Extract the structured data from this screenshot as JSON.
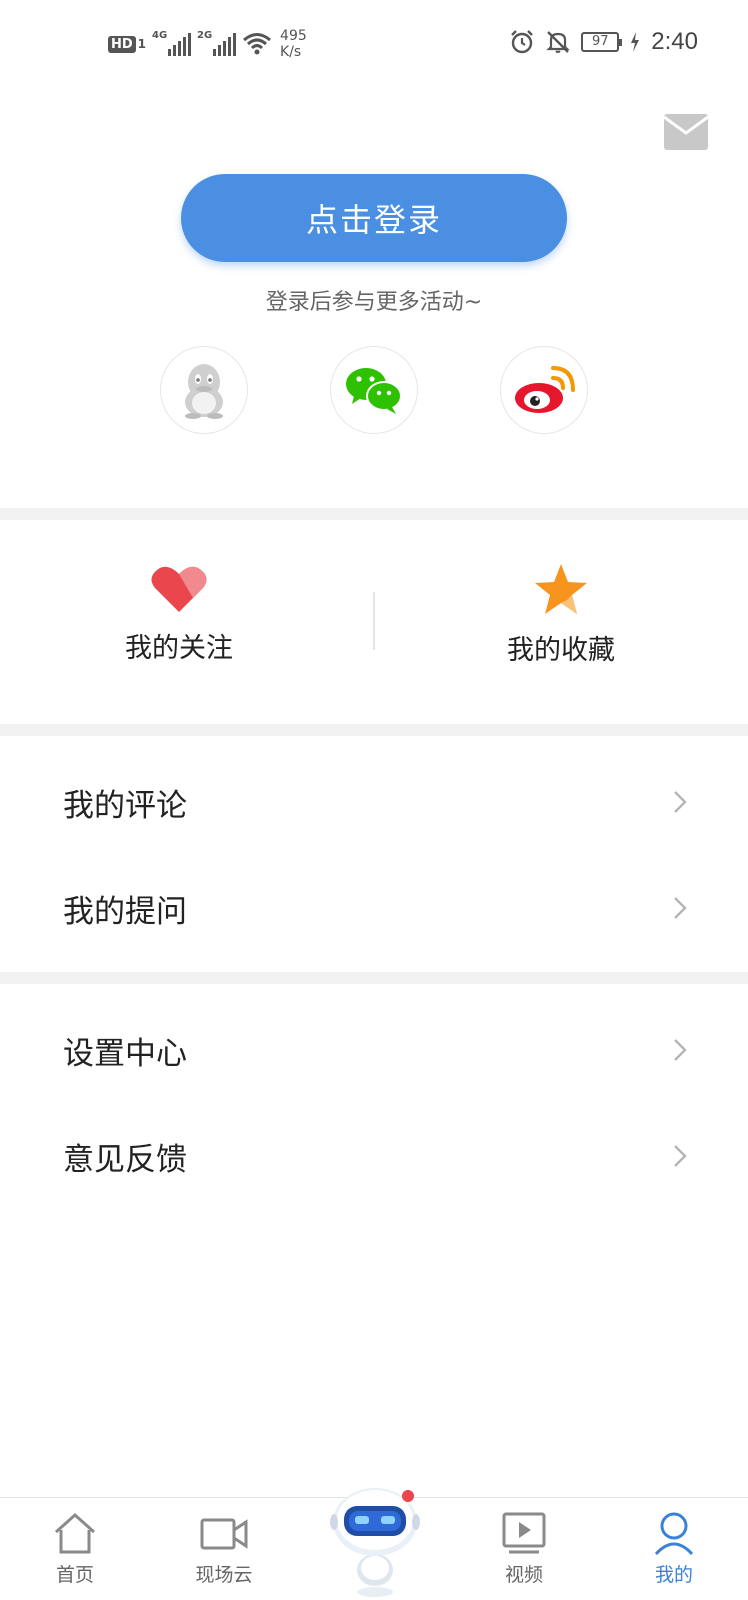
{
  "status_bar": {
    "hd_label": "HD",
    "hd_sub": "1",
    "sim1_gen": "4G",
    "sim2_gen": "2G",
    "speed_value": "495",
    "speed_unit": "K/s",
    "battery": "97",
    "time": "2:40"
  },
  "header": {
    "mail_icon": "mail-icon"
  },
  "login": {
    "button_label": "点击登录",
    "hint": "登录后参与更多活动~"
  },
  "social_login": [
    {
      "name": "qq",
      "icon": "qq-icon"
    },
    {
      "name": "wechat",
      "icon": "wechat-icon"
    },
    {
      "name": "weibo",
      "icon": "weibo-icon"
    }
  ],
  "quick_actions": {
    "follow_label": "我的关注",
    "favorite_label": "我的收藏"
  },
  "menu_group_1": [
    {
      "label": "我的评论"
    },
    {
      "label": "我的提问"
    }
  ],
  "menu_group_2": [
    {
      "label": "设置中心"
    },
    {
      "label": "意见反馈"
    }
  ],
  "bottom_nav": {
    "home": "首页",
    "live_cloud": "现场云",
    "video": "视频",
    "mine": "我的",
    "active": "mine"
  },
  "colors": {
    "accent": "#4a8fe2",
    "heart": "#e9474d",
    "star": "#f7941d",
    "active_tab": "#3b82d6"
  }
}
